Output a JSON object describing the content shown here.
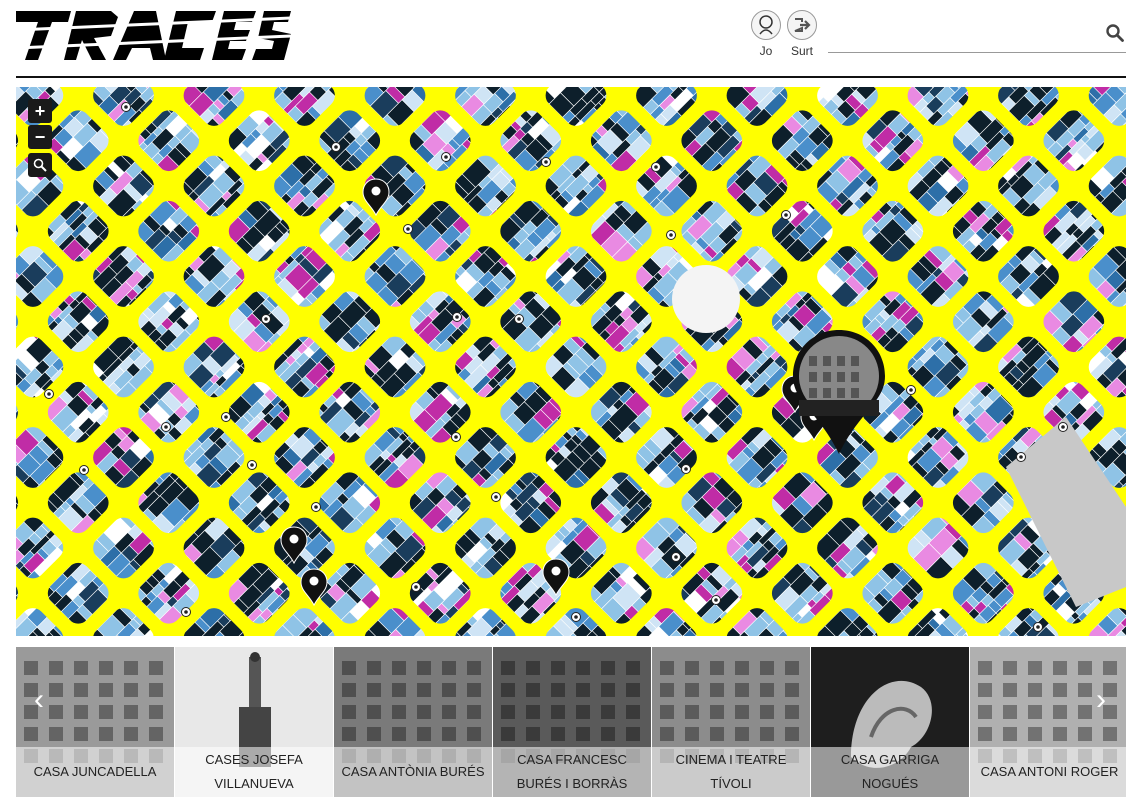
{
  "header": {
    "logo_alt": "TRACES",
    "user": {
      "label": "Jo"
    },
    "logout": {
      "label": "Surt"
    },
    "search": {
      "placeholder": "",
      "value": ""
    }
  },
  "map": {
    "zoom_in": "+",
    "zoom_out": "−"
  },
  "carousel": {
    "items": [
      {
        "title": "CASA JUNCADELLA"
      },
      {
        "title": "CASES JOSEFA VILLANUEVA"
      },
      {
        "title": "CASA ANTÒNIA BURÉS"
      },
      {
        "title": "CASA FRANCESC BURÉS I BORRÀS"
      },
      {
        "title": "CINEMA I TEATRE TÍVOLI"
      },
      {
        "title": "CASA GARRIGA NOGUÉS"
      },
      {
        "title": "CASA ANTONI ROGER"
      }
    ],
    "prev_label": "‹",
    "next_label": "›"
  },
  "colors": {
    "map_background": "#ffff00",
    "block_dark": "#0d1f2b",
    "block_light": "#8fc3e6",
    "block_magenta": "#c02ca6",
    "block_pink": "#e98ae2"
  }
}
